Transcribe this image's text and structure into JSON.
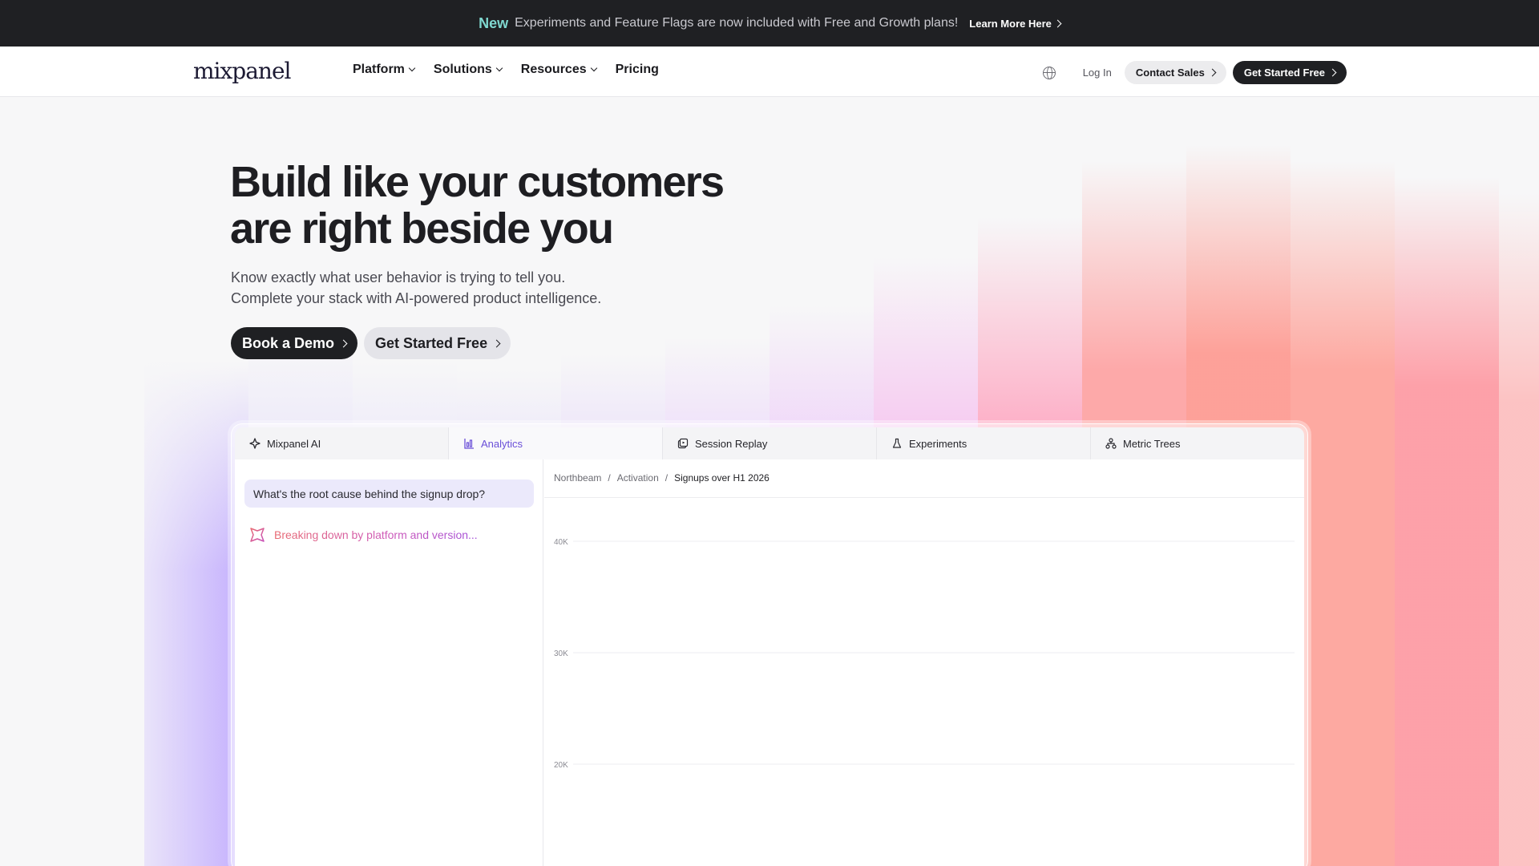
{
  "announcement": {
    "badge": "New",
    "message": "Experiments and Feature Flags are now included with Free and Growth plans!",
    "link_label": "Learn More Here"
  },
  "nav": {
    "logo": "mixpanel",
    "links": [
      {
        "label": "Platform",
        "has_menu": true
      },
      {
        "label": "Solutions",
        "has_menu": true
      },
      {
        "label": "Resources",
        "has_menu": true
      },
      {
        "label": "Pricing",
        "has_menu": false
      }
    ],
    "login_label": "Log In",
    "contact_label": "Contact Sales",
    "get_started_label": "Get Started Free"
  },
  "hero": {
    "title_line1": "Build like your customers",
    "title_line2": "are right beside you",
    "subtitle_line1": "Know exactly what user behavior is trying to tell you.",
    "subtitle_line2": "Complete your stack with AI-powered product intelligence.",
    "cta_primary": "Book a Demo",
    "cta_secondary": "Get Started Free"
  },
  "product": {
    "tabs": [
      {
        "label": "Mixpanel AI",
        "icon": "sparkle-icon",
        "active": false
      },
      {
        "label": "Analytics",
        "icon": "bar-chart-icon",
        "active": true
      },
      {
        "label": "Session Replay",
        "icon": "replay-icon",
        "active": false
      },
      {
        "label": "Experiments",
        "icon": "flask-icon",
        "active": false
      },
      {
        "label": "Metric Trees",
        "icon": "tree-icon",
        "active": false
      }
    ],
    "question": "What's the root cause behind the signup drop?",
    "thinking": "Breaking down by platform and version...",
    "breadcrumb": [
      "Northbeam",
      "Activation",
      "Signups over H1 2026"
    ]
  },
  "chart_data": {
    "type": "line",
    "title": "Signups over H1 2026",
    "y_ticks": [
      "40K",
      "30K",
      "20K"
    ],
    "y_tick_values": [
      40000,
      30000,
      20000
    ],
    "grid": true,
    "series": []
  },
  "colors": {
    "accent": "#6a4fd8",
    "dark": "#1f2023",
    "announce_badge": "#7fd8d0"
  }
}
